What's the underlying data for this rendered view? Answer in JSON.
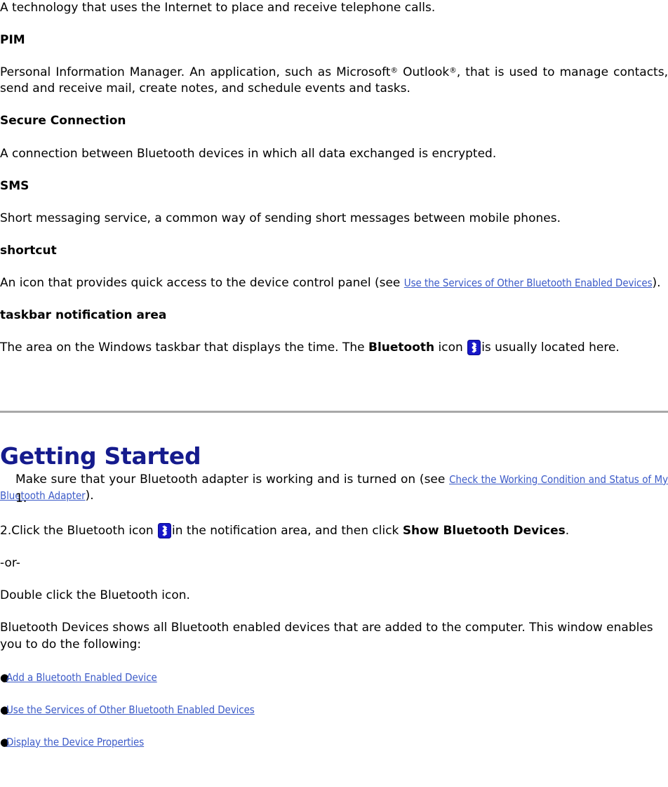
{
  "document": {
    "glossary": [
      {
        "definition_only": true,
        "definition": "A technology that uses the Internet to place and receive telephone calls."
      },
      {
        "term": "PIM",
        "definition_pre": "Personal Information Manager. An application, such as Microsoft",
        "reg1": "®",
        "definition_mid": " Outlook",
        "reg2": "®",
        "definition_post": ", that is used to manage contacts, send and receive mail, create notes, and schedule events and tasks."
      },
      {
        "term": "Secure Connection",
        "definition": "A connection between Bluetooth devices in which all data exchanged is encrypted."
      },
      {
        "term": "SMS",
        "definition": "Short messaging service, a common way of sending short messages between mobile phones."
      },
      {
        "term": "shortcut",
        "definition_pre": "An icon that provides quick access to the device control panel (see ",
        "link": "Use the Services of Other Bluetooth Enabled Devices",
        "definition_post": ")."
      },
      {
        "term": "taskbar notification area",
        "definition_pre": "The area on the Windows taskbar that displays the time. The ",
        "bold": "Bluetooth",
        "definition_mid": " icon ",
        "icon": "bluetooth-icon",
        "definition_post": "is usually located here."
      }
    ],
    "section": {
      "title": "Getting Started",
      "steps": [
        {
          "marker": "1.",
          "text_pre": "Make sure that your Bluetooth adapter is working and is turned on (see ",
          "link": "Check the Working Condition and Status of My Bluetooth Adapter",
          "text_post": ")."
        },
        {
          "marker": "2.",
          "text_pre": "Click the Bluetooth icon ",
          "icon": "bluetooth-icon",
          "text_mid": "in the notification area, and then click ",
          "bold": "Show Bluetooth Devices",
          "text_post": "."
        }
      ],
      "or_separator": "-or-",
      "alt_instruction": "Double click the Bluetooth icon.",
      "intro": "Bluetooth Devices shows all Bluetooth enabled devices that are added to the computer. This window enables you to do the following:",
      "bullet_marker": "●",
      "bullets": [
        "Add a Bluetooth Enabled Device",
        "Use the Services of Other Bluetooth Enabled Devices",
        "Display the Device Properties"
      ]
    }
  },
  "colors": {
    "link": "#3c5bc8",
    "heading": "#151b8d",
    "rule": "#a8a8a8",
    "bluetooth_blue": "#1818c8",
    "text": "#000000"
  }
}
